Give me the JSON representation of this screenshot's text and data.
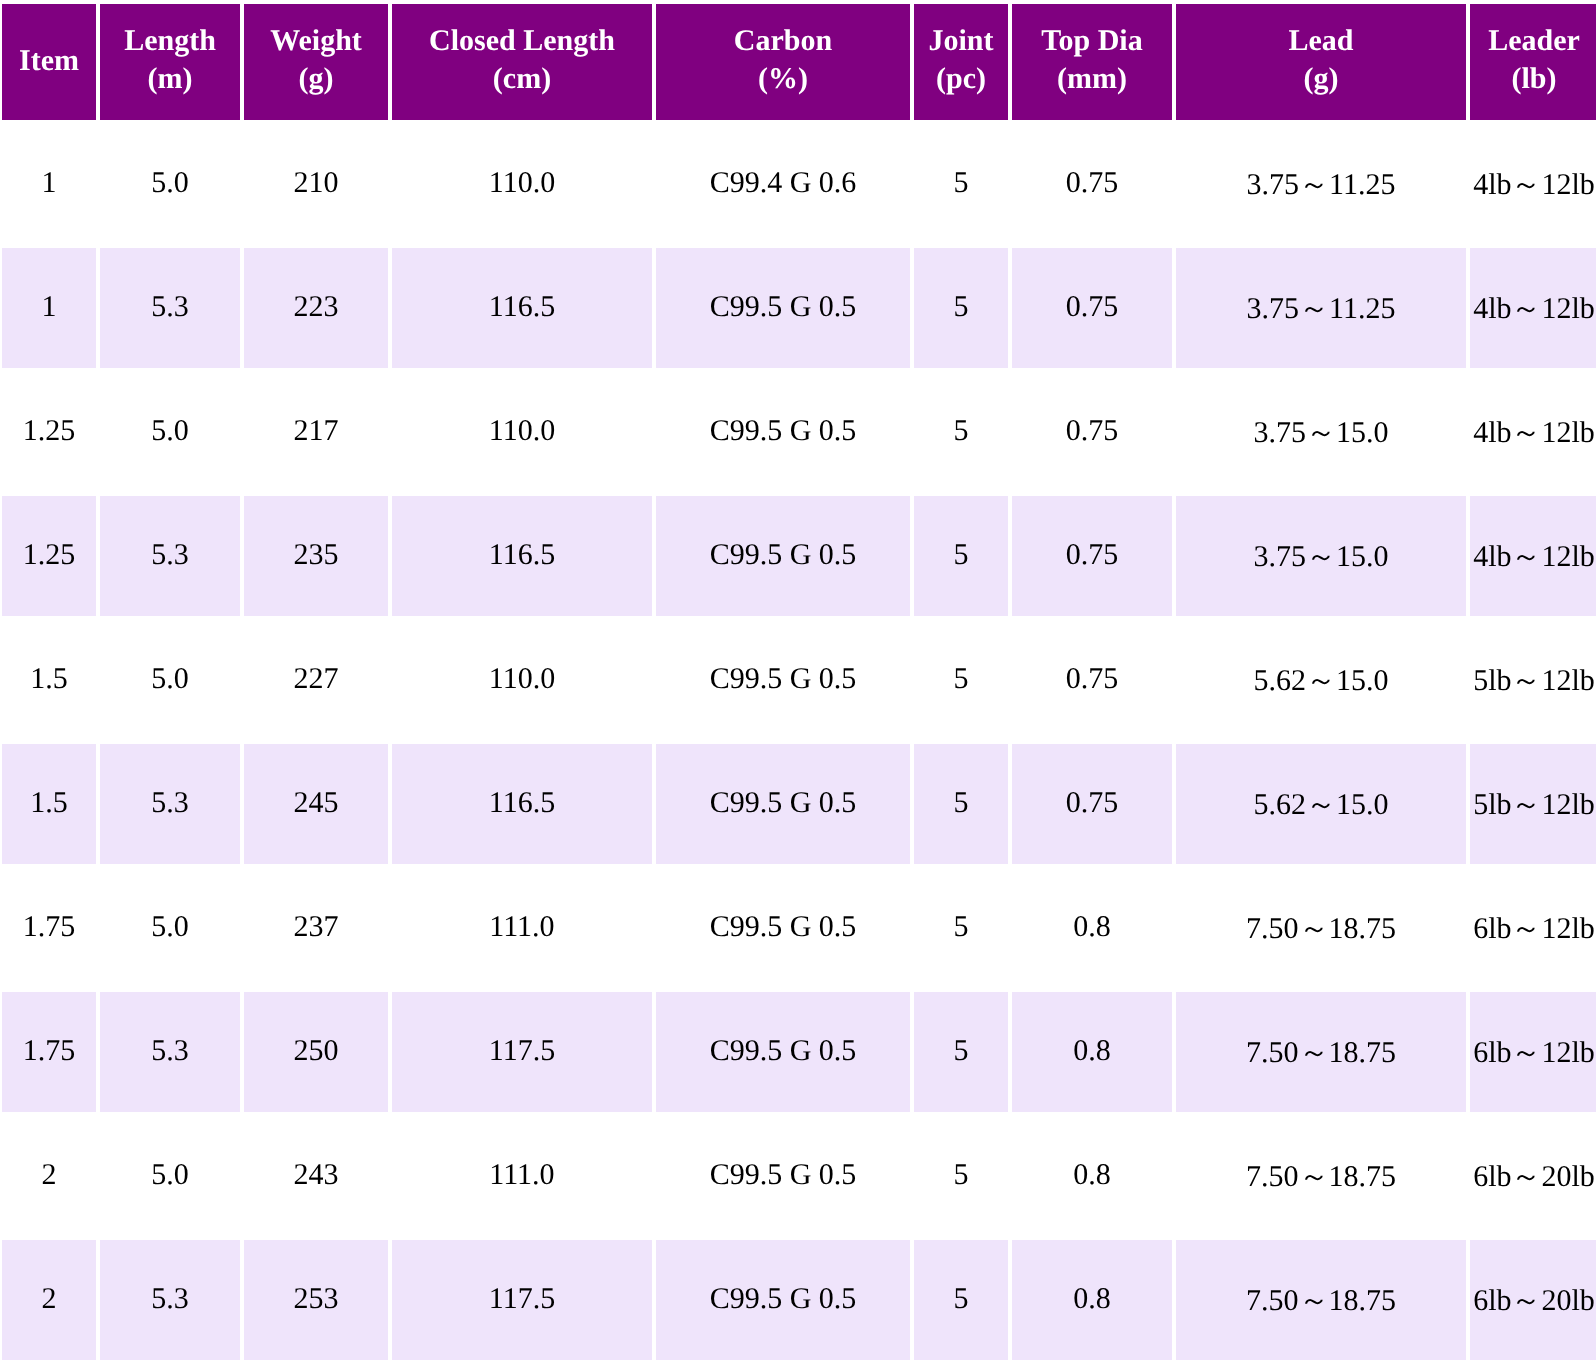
{
  "table": {
    "columns": [
      {
        "title": "Item"
      },
      {
        "title": "Length",
        "unit": "(m)"
      },
      {
        "title": "Weight",
        "unit": "(g)"
      },
      {
        "title": "Closed Length",
        "unit": "(cm)"
      },
      {
        "title": "Carbon",
        "unit": "(%)"
      },
      {
        "title": "Joint",
        "unit": "(pc)"
      },
      {
        "title": "Top Dia",
        "unit": "(mm)"
      },
      {
        "title": "Lead",
        "unit": "(g)"
      },
      {
        "title": "Leader",
        "unit": "(lb)"
      }
    ],
    "rows": [
      [
        "1",
        "5.0",
        "210",
        "110.0",
        "C99.4 G 0.6",
        "5",
        "0.75",
        "3.75～11.25",
        "4lb～12lb"
      ],
      [
        "1",
        "5.3",
        "223",
        "116.5",
        "C99.5 G 0.5",
        "5",
        "0.75",
        "3.75～11.25",
        "4lb～12lb"
      ],
      [
        "1.25",
        "5.0",
        "217",
        "110.0",
        "C99.5 G 0.5",
        "5",
        "0.75",
        "3.75～15.0",
        "4lb～12lb"
      ],
      [
        "1.25",
        "5.3",
        "235",
        "116.5",
        "C99.5 G 0.5",
        "5",
        "0.75",
        "3.75～15.0",
        "4lb～12lb"
      ],
      [
        "1.5",
        "5.0",
        "227",
        "110.0",
        "C99.5 G 0.5",
        "5",
        "0.75",
        "5.62～15.0",
        "5lb～12lb"
      ],
      [
        "1.5",
        "5.3",
        "245",
        "116.5",
        "C99.5 G 0.5",
        "5",
        "0.75",
        "5.62～15.0",
        "5lb～12lb"
      ],
      [
        "1.75",
        "5.0",
        "237",
        "111.0",
        "C99.5 G 0.5",
        "5",
        "0.8",
        "7.50～18.75",
        "6lb～12lb"
      ],
      [
        "1.75",
        "5.3",
        "250",
        "117.5",
        "C99.5 G 0.5",
        "5",
        "0.8",
        "7.50～18.75",
        "6lb～12lb"
      ],
      [
        "2",
        "5.0",
        "243",
        "111.0",
        "C99.5 G 0.5",
        "5",
        "0.8",
        "7.50～18.75",
        "6lb～20lb"
      ],
      [
        "2",
        "5.3",
        "253",
        "117.5",
        "C99.5 G 0.5",
        "5",
        "0.8",
        "7.50～18.75",
        "6lb～20lb"
      ]
    ]
  }
}
